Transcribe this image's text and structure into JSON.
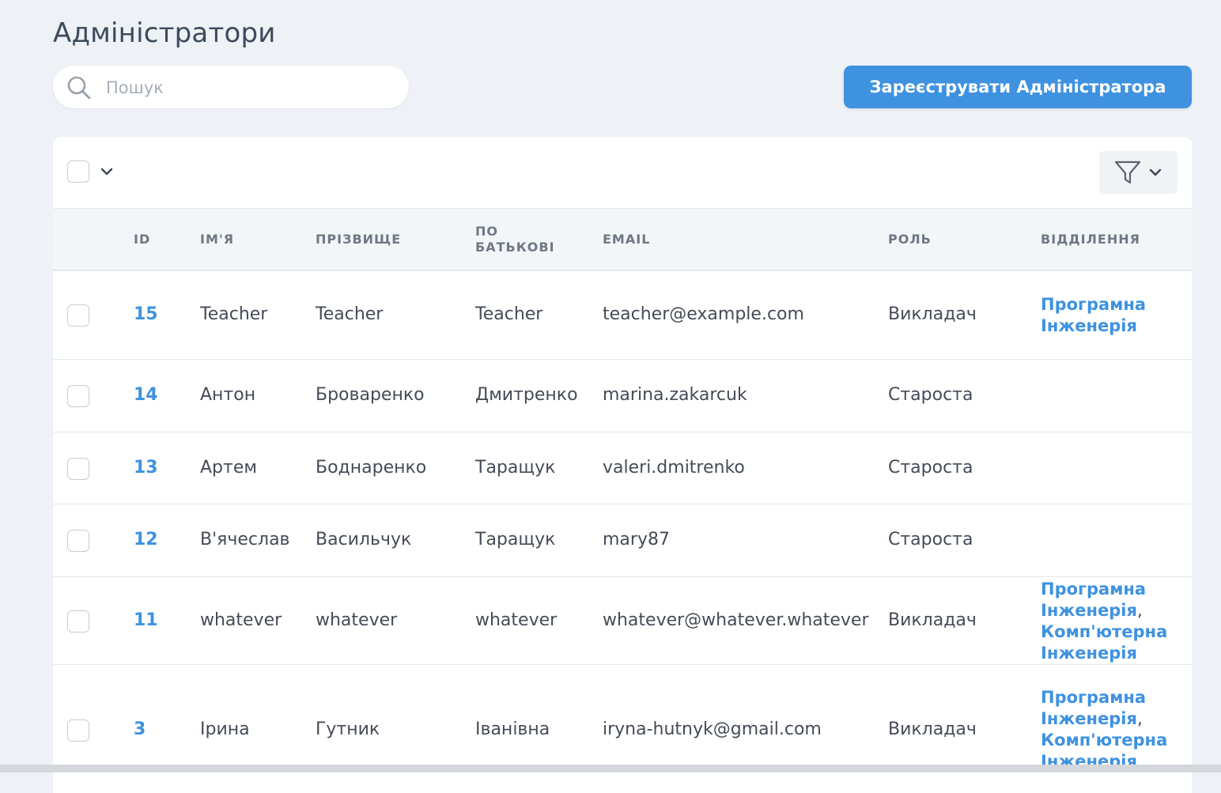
{
  "page": {
    "title": "Адміністратори"
  },
  "search": {
    "placeholder": "Пошук",
    "value": ""
  },
  "register_button": {
    "label": "Зареєструвати Адміністратора"
  },
  "colors": {
    "accent": "#3e92e0",
    "background": "#eef1f5",
    "header_bg": "#f3f6f9"
  },
  "table": {
    "columns": {
      "id": "ID",
      "first_name": "ІМ'Я",
      "last_name": "ПРІЗВИЩЕ",
      "patronymic_line1": "ПО",
      "patronymic_line2": "БАТЬКОВІ",
      "email": "EMAIL",
      "role": "РОЛЬ",
      "department": "ВІДДІЛЕННЯ"
    },
    "rows": [
      {
        "id": "15",
        "first_name": "Teacher",
        "last_name": "Teacher",
        "patronymic": "Teacher",
        "email": "teacher@example.com",
        "role": "Викладач",
        "departments": [
          "Програмна Інженерія"
        ]
      },
      {
        "id": "14",
        "first_name": "Антон",
        "last_name": "Броваренко",
        "patronymic": "Дмитренко",
        "email": "marina.zakarcuk",
        "role": "Староста",
        "departments": []
      },
      {
        "id": "13",
        "first_name": "Артем",
        "last_name": "Боднаренко",
        "patronymic": "Таращук",
        "email": "valeri.dmitrenko",
        "role": "Староста",
        "departments": []
      },
      {
        "id": "12",
        "first_name": "В'ячеслав",
        "last_name": "Васильчук",
        "patronymic": "Таращук",
        "email": "mary87",
        "role": "Староста",
        "departments": []
      },
      {
        "id": "11",
        "first_name": "whatever",
        "last_name": "whatever",
        "patronymic": "whatever",
        "email": "whatever@whatever.whatever",
        "role": "Викладач",
        "departments": [
          "Програмна Інженерія",
          "Комп'ютерна Інженерія"
        ]
      },
      {
        "id": "3",
        "first_name": "Ірина",
        "last_name": "Гутник",
        "patronymic": "Іванівна",
        "email": "iryna-hutnyk@gmail.com",
        "role": "Викладач",
        "departments": [
          "Програмна Інженерія",
          "Комп'ютерна Інженерія"
        ]
      }
    ]
  }
}
